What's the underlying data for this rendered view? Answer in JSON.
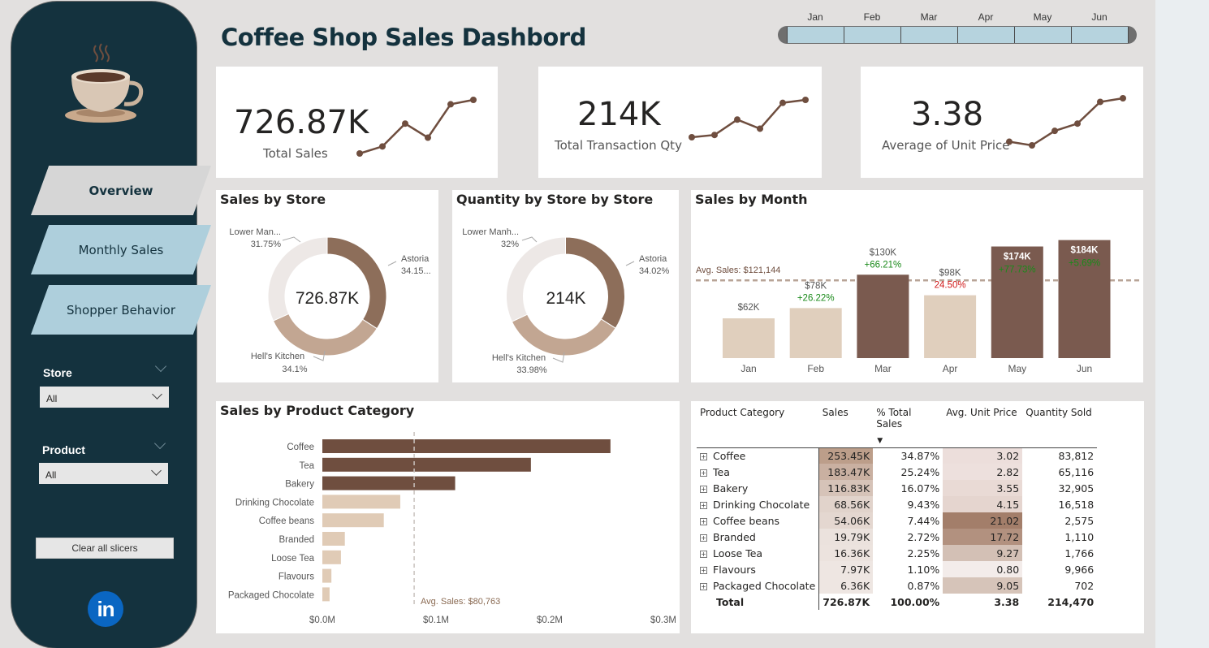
{
  "header": {
    "title": "Coffee Shop Sales Dashbord"
  },
  "timeline": {
    "months": [
      "Jan",
      "Feb",
      "Mar",
      "Apr",
      "May",
      "Jun"
    ]
  },
  "sidebar": {
    "nav": [
      {
        "label": "Overview",
        "active": true
      },
      {
        "label": "Monthly Sales",
        "active": false
      },
      {
        "label": "Shopper Behavior",
        "active": false
      }
    ],
    "slicers": {
      "store": {
        "label": "Store",
        "value": "All"
      },
      "product": {
        "label": "Product",
        "value": "All"
      }
    },
    "clear_label": "Clear all slicers",
    "linkedin_label": "in"
  },
  "kpis": [
    {
      "value": "726.87K",
      "label": "Total Sales",
      "trend": [
        62,
        78,
        130,
        98,
        174,
        184
      ]
    },
    {
      "value": "214K",
      "label": "Total Transaction Qty",
      "trend": [
        18.1,
        20.1,
        33.6,
        25.6,
        48.3,
        50.9
      ]
    },
    {
      "value": "3.38",
      "label": "Average of Unit Price",
      "trend": [
        3.32,
        3.31,
        3.35,
        3.37,
        3.43,
        3.44
      ]
    }
  ],
  "colors": {
    "dark_brown": "#6f4e3f",
    "mid_brown": "#8d6e5a",
    "tan": "#c2a692",
    "beige": "#e3d5c4",
    "light_grey": "#ede8e6",
    "bar_dark": "#7a5a4f",
    "bar_light": "#e0cfbd",
    "positive": "#1a8a1a",
    "negative": "#d11a1a",
    "sidebar": "#14323e"
  },
  "sales_by_store": {
    "title": "Sales by Store",
    "center": "726.87K",
    "chart_data": {
      "type": "pie",
      "labels": [
        "Astoria",
        "Hell's Kitchen",
        "Lower Manhattan"
      ],
      "values": [
        34.15,
        34.1,
        31.75
      ],
      "display_labels": [
        {
          "name": "Astoria",
          "pct": "34.15..."
        },
        {
          "name": "Hell's Kitchen",
          "pct": "34.1%"
        },
        {
          "name": "Lower Man...",
          "pct": "31.75%"
        }
      ]
    }
  },
  "qty_by_store": {
    "title": "Quantity by Store by Store",
    "center": "214K",
    "chart_data": {
      "type": "pie",
      "labels": [
        "Astoria",
        "Hell's Kitchen",
        "Lower Manhattan"
      ],
      "values": [
        34.02,
        33.98,
        32
      ],
      "display_labels": [
        {
          "name": "Astoria",
          "pct": "34.02%"
        },
        {
          "name": "Hell's Kitchen",
          "pct": "33.98%"
        },
        {
          "name": "Lower Manh...",
          "pct": "32%"
        }
      ]
    }
  },
  "sales_by_month": {
    "title": "Sales by Month",
    "avg_label": "Avg. Sales: $121,144",
    "chart_data": {
      "type": "bar",
      "categories": [
        "Jan",
        "Feb",
        "Mar",
        "Apr",
        "May",
        "Jun"
      ],
      "values": [
        62,
        78,
        130,
        98,
        174,
        184
      ],
      "value_labels": [
        "$62K",
        "$78K",
        "$130K",
        "$98K",
        "$174K",
        "$184K"
      ],
      "changes": [
        "",
        "+26.22%",
        "+66.21%",
        "24.50%",
        "+77.73%",
        "+5.69%"
      ],
      "change_positive": [
        true,
        true,
        true,
        false,
        true,
        true
      ],
      "avg_value": 121.144
    }
  },
  "sales_by_category": {
    "title": "Sales by Product Category",
    "avg_label": "Avg. Sales: $80,763",
    "chart_data": {
      "type": "bar",
      "orientation": "horizontal",
      "categories": [
        "Coffee",
        "Tea",
        "Bakery",
        "Drinking Chocolate",
        "Coffee beans",
        "Branded",
        "Loose Tea",
        "Flavours",
        "Packaged Chocolate"
      ],
      "values": [
        253.45,
        183.47,
        116.83,
        68.56,
        54.06,
        19.79,
        16.36,
        7.97,
        6.36
      ],
      "xlim": [
        0,
        300
      ],
      "xticks": [
        "$0.0M",
        "$0.1M",
        "$0.2M",
        "$0.3M"
      ],
      "avg_value": 80.763
    }
  },
  "matrix": {
    "columns": [
      "Product Category",
      "Sales",
      "% Total Sales",
      "Avg. Unit Price",
      "Quantity Sold"
    ],
    "rows": [
      {
        "category": "Coffee",
        "sales": "253.45K",
        "pct": "34.87%",
        "price": "3.02",
        "qty": "83,812",
        "sales_shade": "#bc9e8a",
        "price_shade": "#ecdedb"
      },
      {
        "category": "Tea",
        "sales": "183.47K",
        "pct": "25.24%",
        "price": "2.82",
        "qty": "65,116",
        "sales_shade": "#c9b0a1",
        "price_shade": "#ede0dd"
      },
      {
        "category": "Bakery",
        "sales": "116.83K",
        "pct": "16.07%",
        "price": "3.55",
        "qty": "32,905",
        "sales_shade": "#d6c3b8",
        "price_shade": "#e9dad5"
      },
      {
        "category": "Drinking Chocolate",
        "sales": "68.56K",
        "pct": "9.43%",
        "price": "4.15",
        "qty": "16,518",
        "sales_shade": "#e1d3cb",
        "price_shade": "#e5d5cf"
      },
      {
        "category": "Coffee beans",
        "sales": "54.06K",
        "pct": "7.44%",
        "price": "21.02",
        "qty": "2,575",
        "sales_shade": "#e4d7d0",
        "price_shade": "#a37e6a"
      },
      {
        "category": "Branded",
        "sales": "19.79K",
        "pct": "2.72%",
        "price": "17.72",
        "qty": "1,110",
        "sales_shade": "#ebe2dd",
        "price_shade": "#b2917f"
      },
      {
        "category": "Loose Tea",
        "sales": "16.36K",
        "pct": "2.25%",
        "price": "9.27",
        "qty": "1,766",
        "sales_shade": "#ece3de",
        "price_shade": "#d3c0b5"
      },
      {
        "category": "Flavours",
        "sales": "7.97K",
        "pct": "1.10%",
        "price": "0.80",
        "qty": "9,966",
        "sales_shade": "#eee6e2",
        "price_shade": "#f3ecea"
      },
      {
        "category": "Packaged Chocolate",
        "sales": "6.36K",
        "pct": "0.87%",
        "price": "9.05",
        "qty": "702",
        "sales_shade": "#eee6e2",
        "price_shade": "#d6c4b9"
      }
    ],
    "total": {
      "label": "Total",
      "sales": "726.87K",
      "pct": "100.00%",
      "price": "3.38",
      "qty": "214,470"
    }
  }
}
